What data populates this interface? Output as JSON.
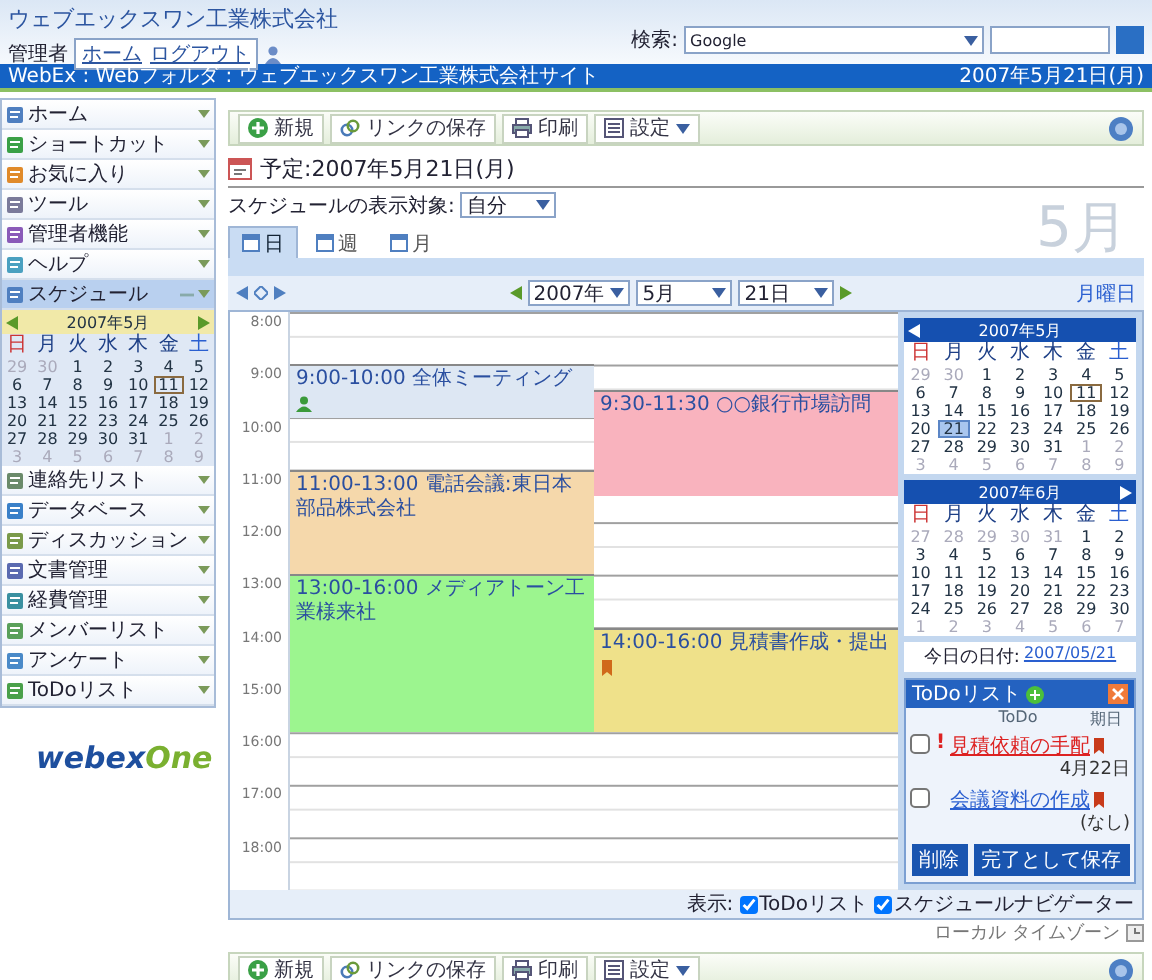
{
  "header": {
    "company": "ウェブエックスワン工業株式会社",
    "user": "管理者",
    "links": [
      "ホーム",
      "ログアウト"
    ],
    "search_label": "検索:",
    "search_engine": "Google"
  },
  "breadcrumb": {
    "path": "WebEx : Webフォルダ : ウェブエックスワン工業株式会社サイト",
    "date": "2007年5月21日(月)"
  },
  "toolbar": [
    {
      "label": "新規",
      "kind": "new"
    },
    {
      "label": "リンクの保存",
      "kind": "link"
    },
    {
      "label": "印刷",
      "kind": "print"
    },
    {
      "label": "設定",
      "kind": "settings"
    }
  ],
  "sidebar": {
    "items": [
      {
        "label": "ホーム",
        "expanded": false
      },
      {
        "label": "ショートカット",
        "expanded": false
      },
      {
        "label": "お気に入り",
        "expanded": false
      },
      {
        "label": "ツール",
        "expanded": false
      },
      {
        "label": "管理者機能",
        "expanded": false
      },
      {
        "label": "ヘルプ",
        "expanded": false
      },
      {
        "label": "スケジュール",
        "expanded": true
      },
      {
        "label": "連絡先リスト",
        "expanded": false
      },
      {
        "label": "データベース",
        "expanded": false
      },
      {
        "label": "ディスカッション",
        "expanded": false
      },
      {
        "label": "文書管理",
        "expanded": false
      },
      {
        "label": "経費管理",
        "expanded": false
      },
      {
        "label": "メンバーリスト",
        "expanded": false
      },
      {
        "label": "アンケート",
        "expanded": false
      },
      {
        "label": "ToDoリスト",
        "expanded": false
      }
    ],
    "calendar": {
      "title": "2007年5月",
      "prev_arrow": true,
      "next_arrow": true,
      "weekdays": [
        "日",
        "月",
        "火",
        "水",
        "木",
        "金",
        "土"
      ],
      "weeks": [
        [
          {
            "text": "29",
            "outside": true,
            "selected": false,
            "today": false
          },
          {
            "text": "30",
            "outside": true,
            "selected": false,
            "today": false
          },
          {
            "text": "1",
            "outside": false,
            "selected": false,
            "today": false
          },
          {
            "text": "2",
            "outside": false,
            "selected": false,
            "today": false
          },
          {
            "text": "3",
            "outside": false,
            "selected": false,
            "today": false
          },
          {
            "text": "4",
            "outside": false,
            "selected": false,
            "today": false
          },
          {
            "text": "5",
            "outside": false,
            "selected": false,
            "today": false
          }
        ],
        [
          {
            "text": "6",
            "outside": false,
            "selected": false,
            "today": false
          },
          {
            "text": "7",
            "outside": false,
            "selected": false,
            "today": false
          },
          {
            "text": "8",
            "outside": false,
            "selected": false,
            "today": false
          },
          {
            "text": "9",
            "outside": false,
            "selected": false,
            "today": false
          },
          {
            "text": "10",
            "outside": false,
            "selected": false,
            "today": false
          },
          {
            "text": "11",
            "outside": false,
            "selected": false,
            "today": true
          },
          {
            "text": "12",
            "outside": false,
            "selected": false,
            "today": false
          }
        ],
        [
          {
            "text": "13",
            "outside": false,
            "selected": false,
            "today": false
          },
          {
            "text": "14",
            "outside": false,
            "selected": false,
            "today": false
          },
          {
            "text": "15",
            "outside": false,
            "selected": false,
            "today": false
          },
          {
            "text": "16",
            "outside": false,
            "selected": false,
            "today": false
          },
          {
            "text": "17",
            "outside": false,
            "selected": false,
            "today": false
          },
          {
            "text": "18",
            "outside": false,
            "selected": false,
            "today": false
          },
          {
            "text": "19",
            "outside": false,
            "selected": false,
            "today": false
          }
        ],
        [
          {
            "text": "20",
            "outside": false,
            "selected": false,
            "today": false
          },
          {
            "text": "21",
            "outside": false,
            "selected": false,
            "today": false
          },
          {
            "text": "22",
            "outside": false,
            "selected": false,
            "today": false
          },
          {
            "text": "23",
            "outside": false,
            "selected": false,
            "today": false
          },
          {
            "text": "24",
            "outside": false,
            "selected": false,
            "today": false
          },
          {
            "text": "25",
            "outside": false,
            "selected": false,
            "today": false
          },
          {
            "text": "26",
            "outside": false,
            "selected": false,
            "today": false
          }
        ],
        [
          {
            "text": "27",
            "outside": false,
            "selected": false,
            "today": false
          },
          {
            "text": "28",
            "outside": false,
            "selected": false,
            "today": false
          },
          {
            "text": "29",
            "outside": false,
            "selected": false,
            "today": false
          },
          {
            "text": "30",
            "outside": false,
            "selected": false,
            "today": false
          },
          {
            "text": "31",
            "outside": false,
            "selected": false,
            "today": false
          },
          {
            "text": "1",
            "outside": true,
            "selected": false,
            "today": false
          },
          {
            "text": "2",
            "outside": true,
            "selected": false,
            "today": false
          }
        ],
        [
          {
            "text": "3",
            "outside": true,
            "selected": false,
            "today": false
          },
          {
            "text": "4",
            "outside": true,
            "selected": false,
            "today": false
          },
          {
            "text": "5",
            "outside": true,
            "selected": false,
            "today": false
          },
          {
            "text": "6",
            "outside": true,
            "selected": false,
            "today": false
          },
          {
            "text": "7",
            "outside": true,
            "selected": false,
            "today": false
          },
          {
            "text": "8",
            "outside": true,
            "selected": false,
            "today": false
          },
          {
            "text": "9",
            "outside": true,
            "selected": false,
            "today": false
          }
        ]
      ]
    },
    "logo": [
      "webex",
      "One"
    ]
  },
  "page": {
    "title": "予定:2007年5月21日(月)",
    "filter_label": "スケジュールの表示対象:",
    "filter_value": "自分",
    "month": "5月",
    "tabs": [
      {
        "label": "日",
        "selected": true
      },
      {
        "label": "週",
        "selected": false
      },
      {
        "label": "月",
        "selected": false
      }
    ],
    "nav": {
      "year": "2007年",
      "month": "5月",
      "day": "21日",
      "weekday": "月曜日"
    }
  },
  "dayview": {
    "hours": [
      "8:00",
      "9:00",
      "10:00",
      "11:00",
      "12:00",
      "13:00",
      "14:00",
      "15:00",
      "16:00",
      "17:00",
      "18:00"
    ],
    "events": [
      {
        "time": "9:00-10:00",
        "title": "全体ミーティング",
        "color": "#dde7f3",
        "kind": "meeting"
      },
      {
        "time": "9:30-11:30",
        "title": "○○銀行市場訪問",
        "color": "#f9b3be",
        "kind": "appointment"
      },
      {
        "time": "11:00-13:00",
        "title": "電話会議:東日本部品株式会社",
        "color": "#f5d8ab",
        "kind": "appointment"
      },
      {
        "time": "13:00-16:00",
        "title": "メディアトーン工業様来社",
        "color": "#9cf58f",
        "kind": "appointment"
      },
      {
        "time": "14:00-16:00",
        "title": "見積書作成・提出",
        "color": "#efe18a",
        "kind": "task"
      }
    ]
  },
  "navigator": {
    "calendars": [
      {
        "title": "2007年5月",
        "prev_arrow": true,
        "next_arrow": false,
        "weekdays": [
          "日",
          "月",
          "火",
          "水",
          "木",
          "金",
          "土"
        ],
        "weeks": [
          [
            {
              "text": "29",
              "outside": true,
              "selected": false,
              "today": false
            },
            {
              "text": "30",
              "outside": true,
              "selected": false,
              "today": false
            },
            {
              "text": "1",
              "outside": false,
              "selected": false,
              "today": false
            },
            {
              "text": "2",
              "outside": false,
              "selected": false,
              "today": false
            },
            {
              "text": "3",
              "outside": false,
              "selected": false,
              "today": false
            },
            {
              "text": "4",
              "outside": false,
              "selected": false,
              "today": false
            },
            {
              "text": "5",
              "outside": false,
              "selected": false,
              "today": false
            }
          ],
          [
            {
              "text": "6",
              "outside": false,
              "selected": false,
              "today": false
            },
            {
              "text": "7",
              "outside": false,
              "selected": false,
              "today": false
            },
            {
              "text": "8",
              "outside": false,
              "selected": false,
              "today": false
            },
            {
              "text": "9",
              "outside": false,
              "selected": false,
              "today": false
            },
            {
              "text": "10",
              "outside": false,
              "selected": false,
              "today": false
            },
            {
              "text": "11",
              "outside": false,
              "selected": false,
              "today": true
            },
            {
              "text": "12",
              "outside": false,
              "selected": false,
              "today": false
            }
          ],
          [
            {
              "text": "13",
              "outside": false,
              "selected": false,
              "today": false
            },
            {
              "text": "14",
              "outside": false,
              "selected": false,
              "today": false
            },
            {
              "text": "15",
              "outside": false,
              "selected": false,
              "today": false
            },
            {
              "text": "16",
              "outside": false,
              "selected": false,
              "today": false
            },
            {
              "text": "17",
              "outside": false,
              "selected": false,
              "today": false
            },
            {
              "text": "18",
              "outside": false,
              "selected": false,
              "today": false
            },
            {
              "text": "19",
              "outside": false,
              "selected": false,
              "today": false
            }
          ],
          [
            {
              "text": "20",
              "outside": false,
              "selected": false,
              "today": false
            },
            {
              "text": "21",
              "outside": false,
              "selected": true,
              "today": false
            },
            {
              "text": "22",
              "outside": false,
              "selected": false,
              "today": false
            },
            {
              "text": "23",
              "outside": false,
              "selected": false,
              "today": false
            },
            {
              "text": "24",
              "outside": false,
              "selected": false,
              "today": false
            },
            {
              "text": "25",
              "outside": false,
              "selected": false,
              "today": false
            },
            {
              "text": "26",
              "outside": false,
              "selected": false,
              "today": false
            }
          ],
          [
            {
              "text": "27",
              "outside": false,
              "selected": false,
              "today": false
            },
            {
              "text": "28",
              "outside": false,
              "selected": false,
              "today": false
            },
            {
              "text": "29",
              "outside": false,
              "selected": false,
              "today": false
            },
            {
              "text": "30",
              "outside": false,
              "selected": false,
              "today": false
            },
            {
              "text": "31",
              "outside": false,
              "selected": false,
              "today": false
            },
            {
              "text": "1",
              "outside": true,
              "selected": false,
              "today": false
            },
            {
              "text": "2",
              "outside": true,
              "selected": false,
              "today": false
            }
          ],
          [
            {
              "text": "3",
              "outside": true,
              "selected": false,
              "today": false
            },
            {
              "text": "4",
              "outside": true,
              "selected": false,
              "today": false
            },
            {
              "text": "5",
              "outside": true,
              "selected": false,
              "today": false
            },
            {
              "text": "6",
              "outside": true,
              "selected": false,
              "today": false
            },
            {
              "text": "7",
              "outside": true,
              "selected": false,
              "today": false
            },
            {
              "text": "8",
              "outside": true,
              "selected": false,
              "today": false
            },
            {
              "text": "9",
              "outside": true,
              "selected": false,
              "today": false
            }
          ]
        ]
      },
      {
        "title": "2007年6月",
        "prev_arrow": false,
        "next_arrow": true,
        "weekdays": [
          "日",
          "月",
          "火",
          "水",
          "木",
          "金",
          "土"
        ],
        "weeks": [
          [
            {
              "text": "27",
              "outside": true,
              "selected": false,
              "today": false
            },
            {
              "text": "28",
              "outside": true,
              "selected": false,
              "today": false
            },
            {
              "text": "29",
              "outside": true,
              "selected": false,
              "today": false
            },
            {
              "text": "30",
              "outside": true,
              "selected": false,
              "today": false
            },
            {
              "text": "31",
              "outside": true,
              "selected": false,
              "today": false
            },
            {
              "text": "1",
              "outside": false,
              "selected": false,
              "today": false
            },
            {
              "text": "2",
              "outside": false,
              "selected": false,
              "today": false
            }
          ],
          [
            {
              "text": "3",
              "outside": false,
              "selected": false,
              "today": false
            },
            {
              "text": "4",
              "outside": false,
              "selected": false,
              "today": false
            },
            {
              "text": "5",
              "outside": false,
              "selected": false,
              "today": false
            },
            {
              "text": "6",
              "outside": false,
              "selected": false,
              "today": false
            },
            {
              "text": "7",
              "outside": false,
              "selected": false,
              "today": false
            },
            {
              "text": "8",
              "outside": false,
              "selected": false,
              "today": false
            },
            {
              "text": "9",
              "outside": false,
              "selected": false,
              "today": false
            }
          ],
          [
            {
              "text": "10",
              "outside": false,
              "selected": false,
              "today": false
            },
            {
              "text": "11",
              "outside": false,
              "selected": false,
              "today": false
            },
            {
              "text": "12",
              "outside": false,
              "selected": false,
              "today": false
            },
            {
              "text": "13",
              "outside": false,
              "selected": false,
              "today": false
            },
            {
              "text": "14",
              "outside": false,
              "selected": false,
              "today": false
            },
            {
              "text": "15",
              "outside": false,
              "selected": false,
              "today": false
            },
            {
              "text": "16",
              "outside": false,
              "selected": false,
              "today": false
            }
          ],
          [
            {
              "text": "17",
              "outside": false,
              "selected": false,
              "today": false
            },
            {
              "text": "18",
              "outside": false,
              "selected": false,
              "today": false
            },
            {
              "text": "19",
              "outside": false,
              "selected": false,
              "today": false
            },
            {
              "text": "20",
              "outside": false,
              "selected": false,
              "today": false
            },
            {
              "text": "21",
              "outside": false,
              "selected": false,
              "today": false
            },
            {
              "text": "22",
              "outside": false,
              "selected": false,
              "today": false
            },
            {
              "text": "23",
              "outside": false,
              "selected": false,
              "today": false
            }
          ],
          [
            {
              "text": "24",
              "outside": false,
              "selected": false,
              "today": false
            },
            {
              "text": "25",
              "outside": false,
              "selected": false,
              "today": false
            },
            {
              "text": "26",
              "outside": false,
              "selected": false,
              "today": false
            },
            {
              "text": "27",
              "outside": false,
              "selected": false,
              "today": false
            },
            {
              "text": "28",
              "outside": false,
              "selected": false,
              "today": false
            },
            {
              "text": "29",
              "outside": false,
              "selected": false,
              "today": false
            },
            {
              "text": "30",
              "outside": false,
              "selected": false,
              "today": false
            }
          ],
          [
            {
              "text": "1",
              "outside": true,
              "selected": false,
              "today": false
            },
            {
              "text": "2",
              "outside": true,
              "selected": false,
              "today": false
            },
            {
              "text": "3",
              "outside": true,
              "selected": false,
              "today": false
            },
            {
              "text": "4",
              "outside": true,
              "selected": false,
              "today": false
            },
            {
              "text": "5",
              "outside": true,
              "selected": false,
              "today": false
            },
            {
              "text": "6",
              "outside": true,
              "selected": false,
              "today": false
            },
            {
              "text": "7",
              "outside": true,
              "selected": false,
              "today": false
            }
          ]
        ]
      }
    ],
    "today_label": "今日の日付:",
    "today_link": "2007/05/21"
  },
  "todo": {
    "title": "ToDoリスト",
    "columns": [
      "ToDo",
      "期日"
    ],
    "items": [
      {
        "priority": "!",
        "title": "見積依頼の手配",
        "due": "4月22日",
        "overdue": true,
        "checked": false
      },
      {
        "title": "会議資料の作成",
        "due": "(なし)",
        "overdue": false,
        "checked": false
      }
    ],
    "buttons": [
      "削除",
      "完了として保存"
    ]
  },
  "footer": {
    "show_label": "表示:",
    "options": [
      {
        "label": "ToDoリスト",
        "checked": true
      },
      {
        "label": "スケジュールナビゲーター",
        "checked": true
      }
    ],
    "timezone": "ローカル タイムゾーン"
  },
  "bottom_toolbar": [
    {
      "label": "新規",
      "kind": "new"
    },
    {
      "label": "リンクの保存",
      "kind": "link"
    },
    {
      "label": "印刷",
      "kind": "print"
    },
    {
      "label": "設定",
      "kind": "settings"
    }
  ]
}
